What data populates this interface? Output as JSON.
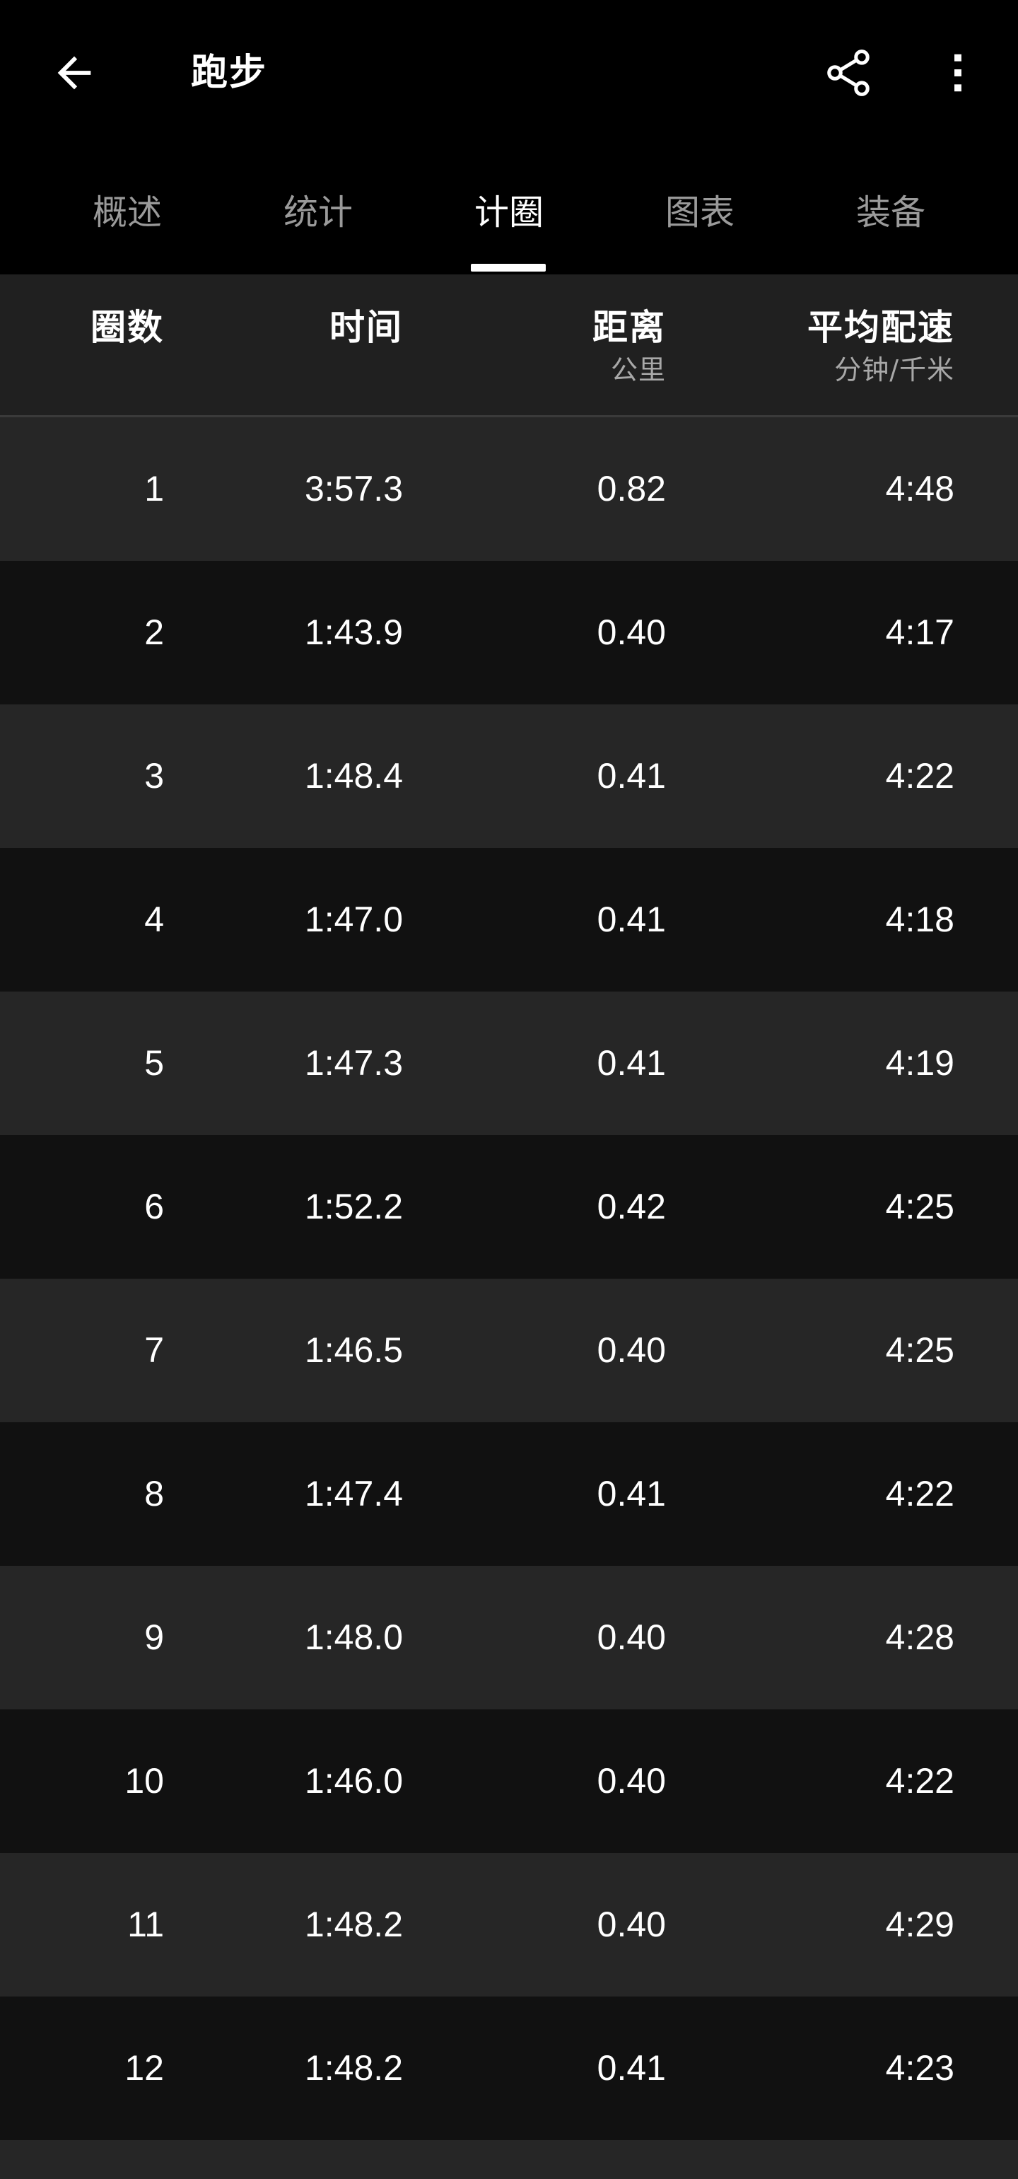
{
  "appbar": {
    "title": "跑步",
    "back_icon": "arrow-left-icon",
    "share_icon": "share-icon",
    "more_icon": "more-vertical-icon"
  },
  "tabs": [
    {
      "label": "概述",
      "active": false
    },
    {
      "label": "统计",
      "active": false
    },
    {
      "label": "计圈",
      "active": true
    },
    {
      "label": "图表",
      "active": false
    },
    {
      "label": "装备",
      "active": false
    }
  ],
  "table": {
    "headers": {
      "laps": {
        "label": "圈数",
        "unit": ""
      },
      "time": {
        "label": "时间",
        "unit": ""
      },
      "distance": {
        "label": "距离",
        "unit": "公里"
      },
      "pace": {
        "label": "平均配速",
        "unit": "分钟/千米"
      }
    },
    "rows": [
      {
        "lap": "1",
        "time": "3:57.3",
        "distance": "0.82",
        "pace": "4:48"
      },
      {
        "lap": "2",
        "time": "1:43.9",
        "distance": "0.40",
        "pace": "4:17"
      },
      {
        "lap": "3",
        "time": "1:48.4",
        "distance": "0.41",
        "pace": "4:22"
      },
      {
        "lap": "4",
        "time": "1:47.0",
        "distance": "0.41",
        "pace": "4:18"
      },
      {
        "lap": "5",
        "time": "1:47.3",
        "distance": "0.41",
        "pace": "4:19"
      },
      {
        "lap": "6",
        "time": "1:52.2",
        "distance": "0.42",
        "pace": "4:25"
      },
      {
        "lap": "7",
        "time": "1:46.5",
        "distance": "0.40",
        "pace": "4:25"
      },
      {
        "lap": "8",
        "time": "1:47.4",
        "distance": "0.41",
        "pace": "4:22"
      },
      {
        "lap": "9",
        "time": "1:48.0",
        "distance": "0.40",
        "pace": "4:28"
      },
      {
        "lap": "10",
        "time": "1:46.0",
        "distance": "0.40",
        "pace": "4:22"
      },
      {
        "lap": "11",
        "time": "1:48.2",
        "distance": "0.40",
        "pace": "4:29"
      },
      {
        "lap": "12",
        "time": "1:48.2",
        "distance": "0.41",
        "pace": "4:23"
      }
    ]
  },
  "colors": {
    "background": "#000000",
    "row_light": "#262626",
    "row_dark": "#111111",
    "text_primary": "#ffffff",
    "text_secondary": "#9a9a9a"
  }
}
